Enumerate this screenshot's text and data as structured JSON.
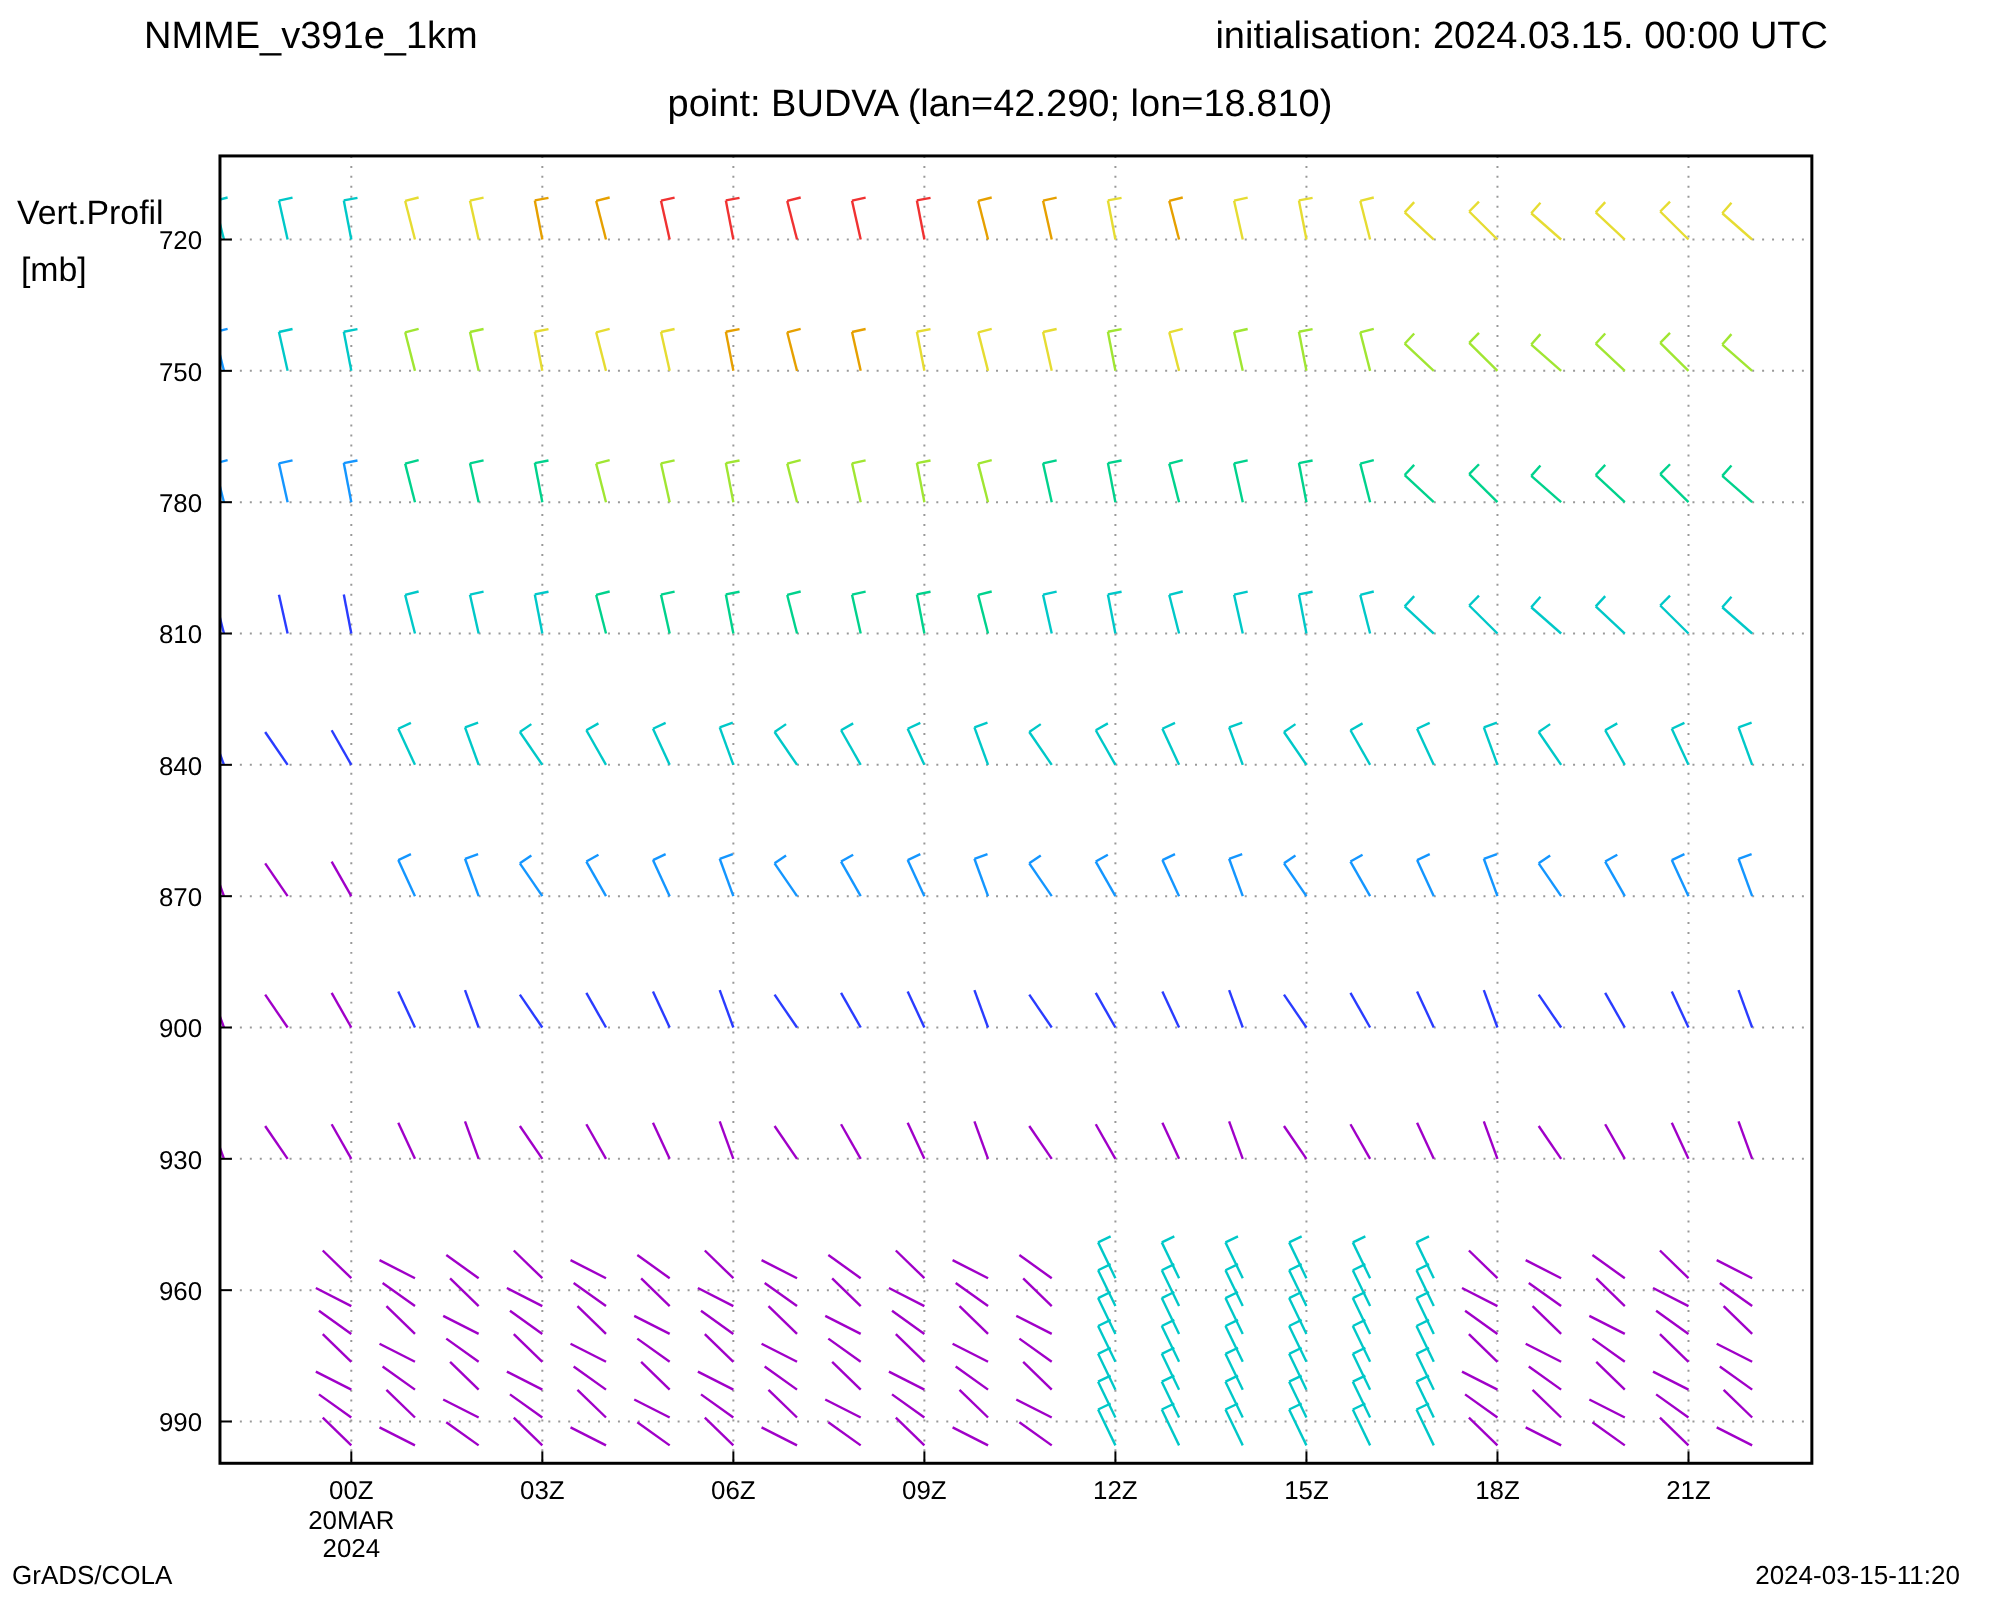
{
  "header": {
    "model": "NMME_v391e_1km",
    "initialisation": "initialisation: 2024.03.15. 00:00 UTC",
    "point": "point: BUDVA (lan=42.290; lon=18.810)"
  },
  "y_axis": {
    "title": "Vert.Profil",
    "unit": "[mb]",
    "ticks": [
      "720",
      "750",
      "780",
      "810",
      "840",
      "870",
      "900",
      "930",
      "960",
      "990"
    ]
  },
  "x_axis": {
    "ticks": [
      "00Z",
      "03Z",
      "06Z",
      "09Z",
      "12Z",
      "15Z",
      "18Z",
      "21Z"
    ],
    "date_label": [
      "20MAR",
      "2024"
    ]
  },
  "footer": {
    "left": "GrADS/COLA",
    "right": "2024-03-15-11:20"
  }
}
